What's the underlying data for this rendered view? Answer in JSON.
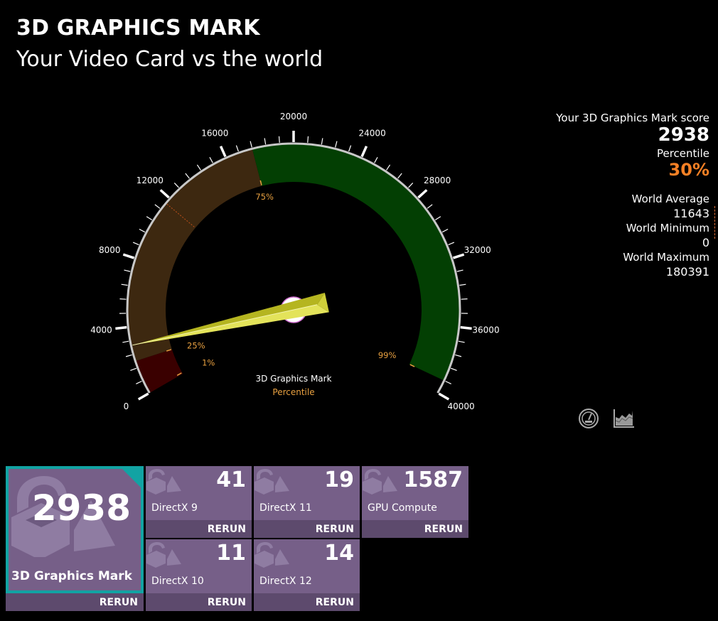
{
  "header": {
    "title": "3D GRAPHICS MARK",
    "subtitle": "Your Video Card vs the world"
  },
  "stats": {
    "score_label": "Your 3D Graphics Mark score",
    "score": "2938",
    "percentile_label": "Percentile",
    "percentile": "30%",
    "world_average_label": "World Average",
    "world_average": "11643",
    "world_minimum_label": "World Minimum",
    "world_minimum": "0",
    "world_maximum_label": "World Maximum",
    "world_maximum": "180391"
  },
  "chart_data": {
    "type": "gauge",
    "title": "3D Graphics Mark",
    "subtitle": "Percentile",
    "range": [
      0,
      40000
    ],
    "major_ticks": [
      0,
      4000,
      8000,
      12000,
      16000,
      20000,
      24000,
      28000,
      32000,
      36000,
      40000
    ],
    "tick_labels": [
      "0",
      "4000",
      "8000",
      "12000",
      "16000",
      "20000",
      "24000",
      "28000",
      "32000",
      "36000",
      "40000"
    ],
    "minor_tick_step": 800,
    "value": 2938,
    "world_average": 11643,
    "bands": [
      {
        "name": "below-25th-percentile",
        "from": 0,
        "to": 2000,
        "color": "#3a0000"
      },
      {
        "name": "25th-to-75th-percentile",
        "from": 2000,
        "to": 17600,
        "color": "#3d2810"
      },
      {
        "name": "75th-to-99th-percentile",
        "from": 17600,
        "to": 39200,
        "color": "#033f03"
      }
    ],
    "percentile_markers": [
      {
        "label": "1%",
        "value": 100
      },
      {
        "label": "25%",
        "value": 2000
      },
      {
        "label": "75%",
        "value": 17600
      },
      {
        "label": "99%",
        "value": 39200
      }
    ]
  },
  "colors": {
    "accent_orange": "#f58025",
    "marker_orange": "#e8a040",
    "needle": "#d8d840",
    "tile": "#765f88",
    "tile_bar": "#5d4a6d",
    "selected_border": "#12a3a3"
  },
  "toolbar": {
    "gauge_view_icon": "gauge-icon",
    "chart_view_icon": "chart-icon"
  },
  "tiles": {
    "main": {
      "score": "2938",
      "name": "3D Graphics Mark",
      "rerun": "RERUN"
    },
    "dx9": {
      "score": "41",
      "name": "DirectX 9",
      "rerun": "RERUN"
    },
    "dx11": {
      "score": "19",
      "name": "DirectX 11",
      "rerun": "RERUN"
    },
    "gpu": {
      "score": "1587",
      "name": "GPU Compute",
      "rerun": "RERUN"
    },
    "dx10": {
      "score": "11",
      "name": "DirectX 10",
      "rerun": "RERUN"
    },
    "dx12": {
      "score": "14",
      "name": "DirectX 12",
      "rerun": "RERUN"
    }
  }
}
